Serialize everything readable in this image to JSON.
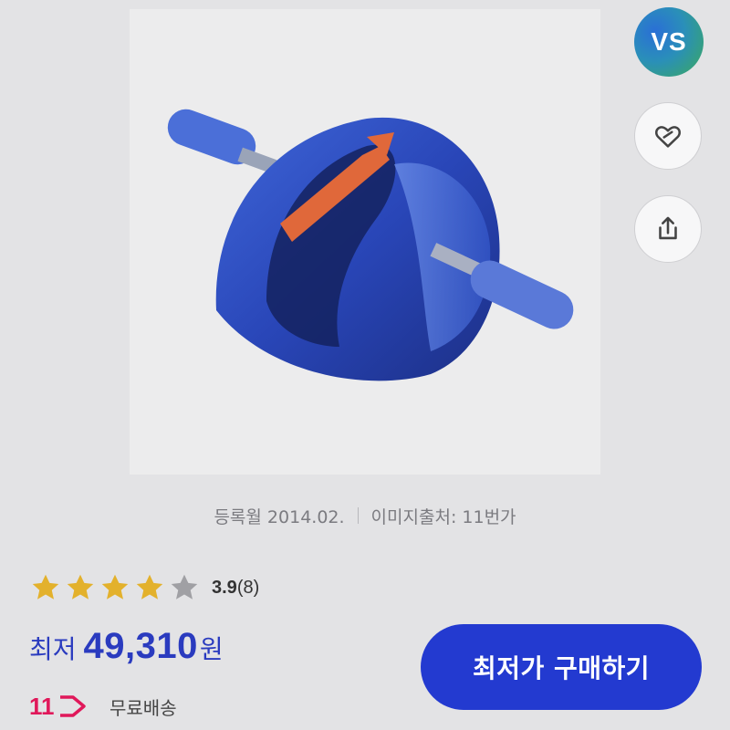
{
  "avatar": {
    "initials": "VS"
  },
  "actions": {
    "wishlist_icon": "heart-icon",
    "share_icon": "share-icon"
  },
  "product": {
    "image_alt": "product-image",
    "registered": "등록월 2014.02.",
    "image_source": "이미지출처: 11번가"
  },
  "rating": {
    "score": "3.9",
    "count": "(8)",
    "stars_filled": 4,
    "stars_total": 5
  },
  "price": {
    "label": "최저",
    "value": "49,310",
    "unit": "원"
  },
  "seller": {
    "logo_text": "11",
    "shipping": "무료배송"
  },
  "buy_button": {
    "label": "최저가 구매하기"
  },
  "colors": {
    "accent": "#233ad0",
    "price": "#2a3bbf",
    "star": "#e3b12c",
    "star_empty": "#a0a0a4",
    "seller_logo": "#e0185a"
  }
}
